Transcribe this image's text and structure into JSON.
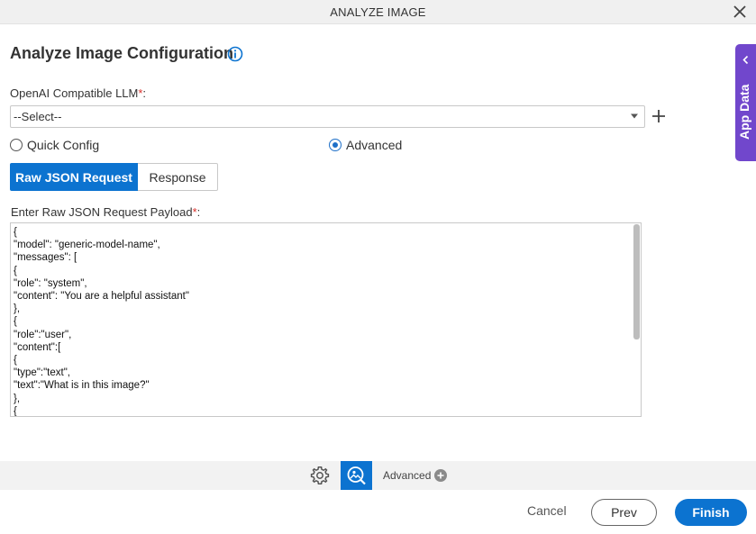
{
  "window": {
    "title": "ANALYZE IMAGE"
  },
  "page": {
    "heading": "Analyze Image Configuration"
  },
  "side_panel": {
    "label": "App Data"
  },
  "llm": {
    "label": "OpenAI Compatible LLM",
    "required_mark": "*",
    "colon": ":",
    "selected": "--Select--"
  },
  "config_mode": {
    "options": [
      {
        "label": "Quick Config",
        "checked": false
      },
      {
        "label": "Advanced",
        "checked": true
      }
    ]
  },
  "tabs": [
    {
      "label": "Raw JSON Request",
      "active": true
    },
    {
      "label": "Response",
      "active": false
    }
  ],
  "payload": {
    "label": "Enter Raw JSON Request Payload",
    "required_mark": "*",
    "colon": ":",
    "lines": [
      "{",
      "\"model\": \"generic-model-name\",",
      "\"messages\": [",
      "{",
      "\"role\": \"system\",",
      "\"content\": \"You are a helpful assistant\"",
      "},",
      "{",
      "\"role\":\"user\",",
      "\"content\":[",
      "{",
      "\"type\":\"text\",",
      "\"text\":\"What is in this image?\"",
      "},",
      "{"
    ]
  },
  "bottom_toolbar": {
    "advanced_label": "Advanced"
  },
  "footer": {
    "cancel": "Cancel",
    "prev": "Prev",
    "finish": "Finish"
  },
  "colors": {
    "primary": "#0c73d0",
    "side_panel": "#7147cc",
    "required": "#d9312c"
  }
}
